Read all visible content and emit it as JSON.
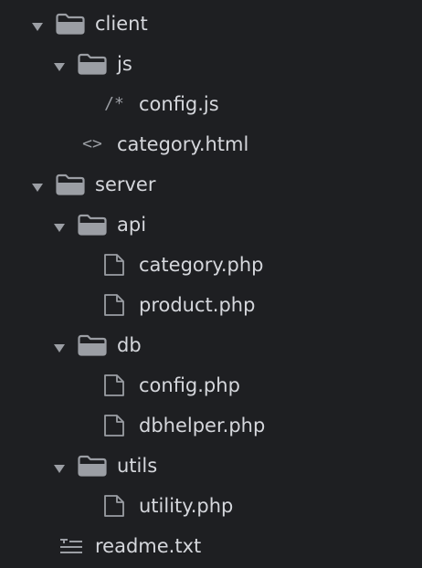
{
  "colors": {
    "background": "#1e1f22",
    "text": "#d5d7dc",
    "icon": "#9b9ea4"
  },
  "tree": [
    {
      "label": "client",
      "type": "folder",
      "expanded": true,
      "depth": 0,
      "icon": "folder-icon"
    },
    {
      "label": "js",
      "type": "folder",
      "expanded": true,
      "depth": 1,
      "icon": "folder-icon"
    },
    {
      "label": "config.js",
      "type": "file",
      "depth": 2,
      "icon": "comment-icon",
      "icon_text": "/*"
    },
    {
      "label": "category.html",
      "type": "file",
      "depth": 1,
      "icon": "code-icon",
      "icon_text": "<>"
    },
    {
      "label": "server",
      "type": "folder",
      "expanded": true,
      "depth": 0,
      "icon": "folder-icon"
    },
    {
      "label": "api",
      "type": "folder",
      "expanded": true,
      "depth": 1,
      "icon": "folder-icon"
    },
    {
      "label": "category.php",
      "type": "file",
      "depth": 2,
      "icon": "file-icon"
    },
    {
      "label": "product.php",
      "type": "file",
      "depth": 2,
      "icon": "file-icon"
    },
    {
      "label": "db",
      "type": "folder",
      "expanded": true,
      "depth": 1,
      "icon": "folder-icon"
    },
    {
      "label": "config.php",
      "type": "file",
      "depth": 2,
      "icon": "file-icon"
    },
    {
      "label": "dbhelper.php",
      "type": "file",
      "depth": 2,
      "icon": "file-icon"
    },
    {
      "label": "utils",
      "type": "folder",
      "expanded": true,
      "depth": 1,
      "icon": "folder-icon"
    },
    {
      "label": "utility.php",
      "type": "file",
      "depth": 2,
      "icon": "file-icon"
    },
    {
      "label": "readme.txt",
      "type": "file",
      "depth": 0,
      "icon": "text-lines-icon"
    }
  ]
}
